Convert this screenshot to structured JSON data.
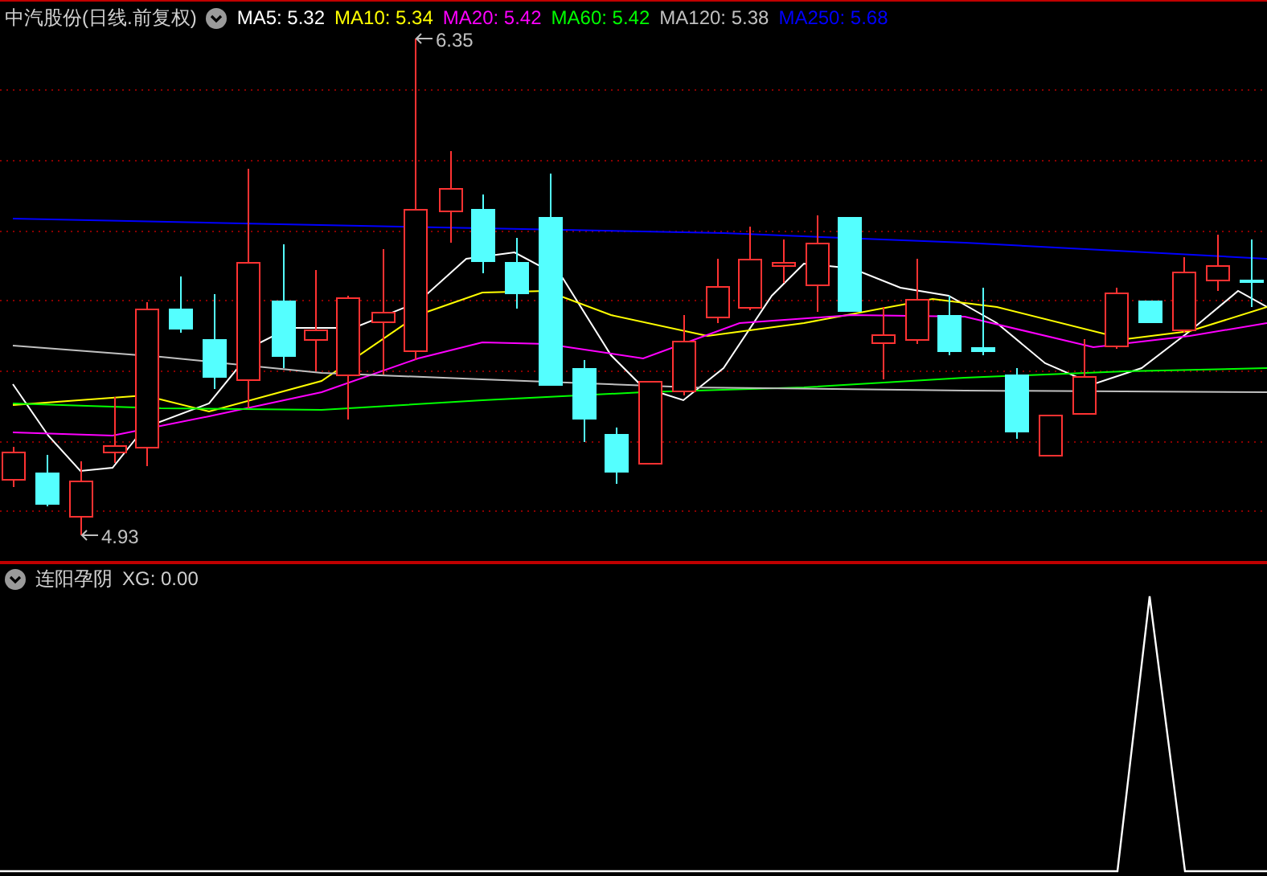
{
  "main_panel": {
    "title": "中汽股份(日线.前复权)",
    "indicators": [
      {
        "label": "MA5: 5.32",
        "color": "#ffffff"
      },
      {
        "label": "MA10: 5.34",
        "color": "#ffff00"
      },
      {
        "label": "MA20: 5.42",
        "color": "#ff00ff"
      },
      {
        "label": "MA60: 5.42",
        "color": "#00ff00"
      },
      {
        "label": "MA120: 5.38",
        "color": "#c0c0c0"
      },
      {
        "label": "MA250: 5.68",
        "color": "#0000ff"
      }
    ]
  },
  "price_marks": [
    {
      "label": "6.35",
      "kind": "high"
    },
    {
      "label": "4.93",
      "kind": "low"
    }
  ],
  "indicator_panel": {
    "title": "连阳孕阴",
    "reading": "XG: 0.00"
  }
}
